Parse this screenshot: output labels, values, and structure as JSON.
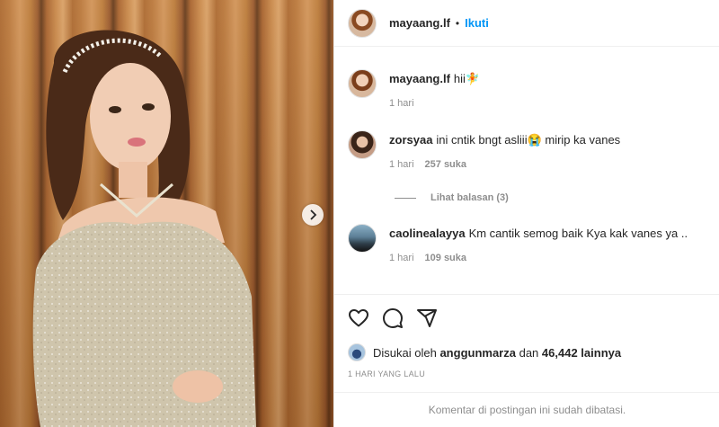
{
  "post": {
    "username": "mayaang.lf",
    "follow_label": "Ikuti",
    "separator": "•"
  },
  "caption": {
    "username": "mayaang.lf",
    "text": "hii🧚",
    "time": "1 hari"
  },
  "comments": [
    {
      "username": "zorsyaa",
      "text": "ini cntik bngt asliii😭 mirip ka vanes",
      "time": "1 hari",
      "likes": "257 suka"
    },
    {
      "username": "caolinealayya",
      "text": "Km cantik semog baik Kya kak vanes ya ..",
      "time": "1 hari",
      "likes": "109 suka"
    }
  ],
  "view_replies_label": "Lihat balasan (3)",
  "likes": {
    "prefix": "Disukai oleh",
    "user": "anggunmarza",
    "conjunction": "dan",
    "count": "46,442 lainnya"
  },
  "timestamp": "1 HARI YANG LALU",
  "footer_note": "Komentar di postingan ini sudah dibatasi.",
  "icons": {
    "like": "heart-icon",
    "comment": "comment-icon",
    "share": "share-icon",
    "next": "chevron-right-icon"
  }
}
